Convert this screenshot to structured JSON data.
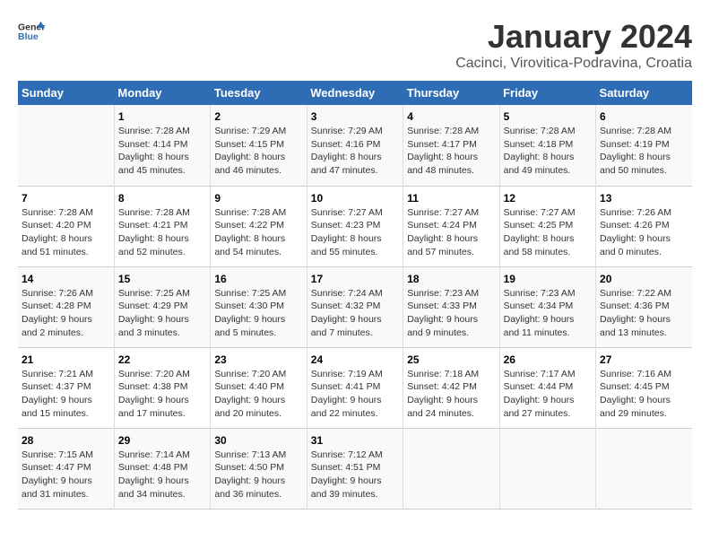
{
  "logo": {
    "general": "General",
    "blue": "Blue"
  },
  "title": "January 2024",
  "subtitle": "Cacinci, Virovitica-Podravina, Croatia",
  "days_header": [
    "Sunday",
    "Monday",
    "Tuesday",
    "Wednesday",
    "Thursday",
    "Friday",
    "Saturday"
  ],
  "weeks": [
    [
      {
        "day": "",
        "sunrise": "",
        "sunset": "",
        "daylight": ""
      },
      {
        "day": "1",
        "sunrise": "Sunrise: 7:28 AM",
        "sunset": "Sunset: 4:14 PM",
        "daylight": "Daylight: 8 hours and 45 minutes."
      },
      {
        "day": "2",
        "sunrise": "Sunrise: 7:29 AM",
        "sunset": "Sunset: 4:15 PM",
        "daylight": "Daylight: 8 hours and 46 minutes."
      },
      {
        "day": "3",
        "sunrise": "Sunrise: 7:29 AM",
        "sunset": "Sunset: 4:16 PM",
        "daylight": "Daylight: 8 hours and 47 minutes."
      },
      {
        "day": "4",
        "sunrise": "Sunrise: 7:28 AM",
        "sunset": "Sunset: 4:17 PM",
        "daylight": "Daylight: 8 hours and 48 minutes."
      },
      {
        "day": "5",
        "sunrise": "Sunrise: 7:28 AM",
        "sunset": "Sunset: 4:18 PM",
        "daylight": "Daylight: 8 hours and 49 minutes."
      },
      {
        "day": "6",
        "sunrise": "Sunrise: 7:28 AM",
        "sunset": "Sunset: 4:19 PM",
        "daylight": "Daylight: 8 hours and 50 minutes."
      }
    ],
    [
      {
        "day": "7",
        "sunrise": "Sunrise: 7:28 AM",
        "sunset": "Sunset: 4:20 PM",
        "daylight": "Daylight: 8 hours and 51 minutes."
      },
      {
        "day": "8",
        "sunrise": "Sunrise: 7:28 AM",
        "sunset": "Sunset: 4:21 PM",
        "daylight": "Daylight: 8 hours and 52 minutes."
      },
      {
        "day": "9",
        "sunrise": "Sunrise: 7:28 AM",
        "sunset": "Sunset: 4:22 PM",
        "daylight": "Daylight: 8 hours and 54 minutes."
      },
      {
        "day": "10",
        "sunrise": "Sunrise: 7:27 AM",
        "sunset": "Sunset: 4:23 PM",
        "daylight": "Daylight: 8 hours and 55 minutes."
      },
      {
        "day": "11",
        "sunrise": "Sunrise: 7:27 AM",
        "sunset": "Sunset: 4:24 PM",
        "daylight": "Daylight: 8 hours and 57 minutes."
      },
      {
        "day": "12",
        "sunrise": "Sunrise: 7:27 AM",
        "sunset": "Sunset: 4:25 PM",
        "daylight": "Daylight: 8 hours and 58 minutes."
      },
      {
        "day": "13",
        "sunrise": "Sunrise: 7:26 AM",
        "sunset": "Sunset: 4:26 PM",
        "daylight": "Daylight: 9 hours and 0 minutes."
      }
    ],
    [
      {
        "day": "14",
        "sunrise": "Sunrise: 7:26 AM",
        "sunset": "Sunset: 4:28 PM",
        "daylight": "Daylight: 9 hours and 2 minutes."
      },
      {
        "day": "15",
        "sunrise": "Sunrise: 7:25 AM",
        "sunset": "Sunset: 4:29 PM",
        "daylight": "Daylight: 9 hours and 3 minutes."
      },
      {
        "day": "16",
        "sunrise": "Sunrise: 7:25 AM",
        "sunset": "Sunset: 4:30 PM",
        "daylight": "Daylight: 9 hours and 5 minutes."
      },
      {
        "day": "17",
        "sunrise": "Sunrise: 7:24 AM",
        "sunset": "Sunset: 4:32 PM",
        "daylight": "Daylight: 9 hours and 7 minutes."
      },
      {
        "day": "18",
        "sunrise": "Sunrise: 7:23 AM",
        "sunset": "Sunset: 4:33 PM",
        "daylight": "Daylight: 9 hours and 9 minutes."
      },
      {
        "day": "19",
        "sunrise": "Sunrise: 7:23 AM",
        "sunset": "Sunset: 4:34 PM",
        "daylight": "Daylight: 9 hours and 11 minutes."
      },
      {
        "day": "20",
        "sunrise": "Sunrise: 7:22 AM",
        "sunset": "Sunset: 4:36 PM",
        "daylight": "Daylight: 9 hours and 13 minutes."
      }
    ],
    [
      {
        "day": "21",
        "sunrise": "Sunrise: 7:21 AM",
        "sunset": "Sunset: 4:37 PM",
        "daylight": "Daylight: 9 hours and 15 minutes."
      },
      {
        "day": "22",
        "sunrise": "Sunrise: 7:20 AM",
        "sunset": "Sunset: 4:38 PM",
        "daylight": "Daylight: 9 hours and 17 minutes."
      },
      {
        "day": "23",
        "sunrise": "Sunrise: 7:20 AM",
        "sunset": "Sunset: 4:40 PM",
        "daylight": "Daylight: 9 hours and 20 minutes."
      },
      {
        "day": "24",
        "sunrise": "Sunrise: 7:19 AM",
        "sunset": "Sunset: 4:41 PM",
        "daylight": "Daylight: 9 hours and 22 minutes."
      },
      {
        "day": "25",
        "sunrise": "Sunrise: 7:18 AM",
        "sunset": "Sunset: 4:42 PM",
        "daylight": "Daylight: 9 hours and 24 minutes."
      },
      {
        "day": "26",
        "sunrise": "Sunrise: 7:17 AM",
        "sunset": "Sunset: 4:44 PM",
        "daylight": "Daylight: 9 hours and 27 minutes."
      },
      {
        "day": "27",
        "sunrise": "Sunrise: 7:16 AM",
        "sunset": "Sunset: 4:45 PM",
        "daylight": "Daylight: 9 hours and 29 minutes."
      }
    ],
    [
      {
        "day": "28",
        "sunrise": "Sunrise: 7:15 AM",
        "sunset": "Sunset: 4:47 PM",
        "daylight": "Daylight: 9 hours and 31 minutes."
      },
      {
        "day": "29",
        "sunrise": "Sunrise: 7:14 AM",
        "sunset": "Sunset: 4:48 PM",
        "daylight": "Daylight: 9 hours and 34 minutes."
      },
      {
        "day": "30",
        "sunrise": "Sunrise: 7:13 AM",
        "sunset": "Sunset: 4:50 PM",
        "daylight": "Daylight: 9 hours and 36 minutes."
      },
      {
        "day": "31",
        "sunrise": "Sunrise: 7:12 AM",
        "sunset": "Sunset: 4:51 PM",
        "daylight": "Daylight: 9 hours and 39 minutes."
      },
      {
        "day": "",
        "sunrise": "",
        "sunset": "",
        "daylight": ""
      },
      {
        "day": "",
        "sunrise": "",
        "sunset": "",
        "daylight": ""
      },
      {
        "day": "",
        "sunrise": "",
        "sunset": "",
        "daylight": ""
      }
    ]
  ]
}
